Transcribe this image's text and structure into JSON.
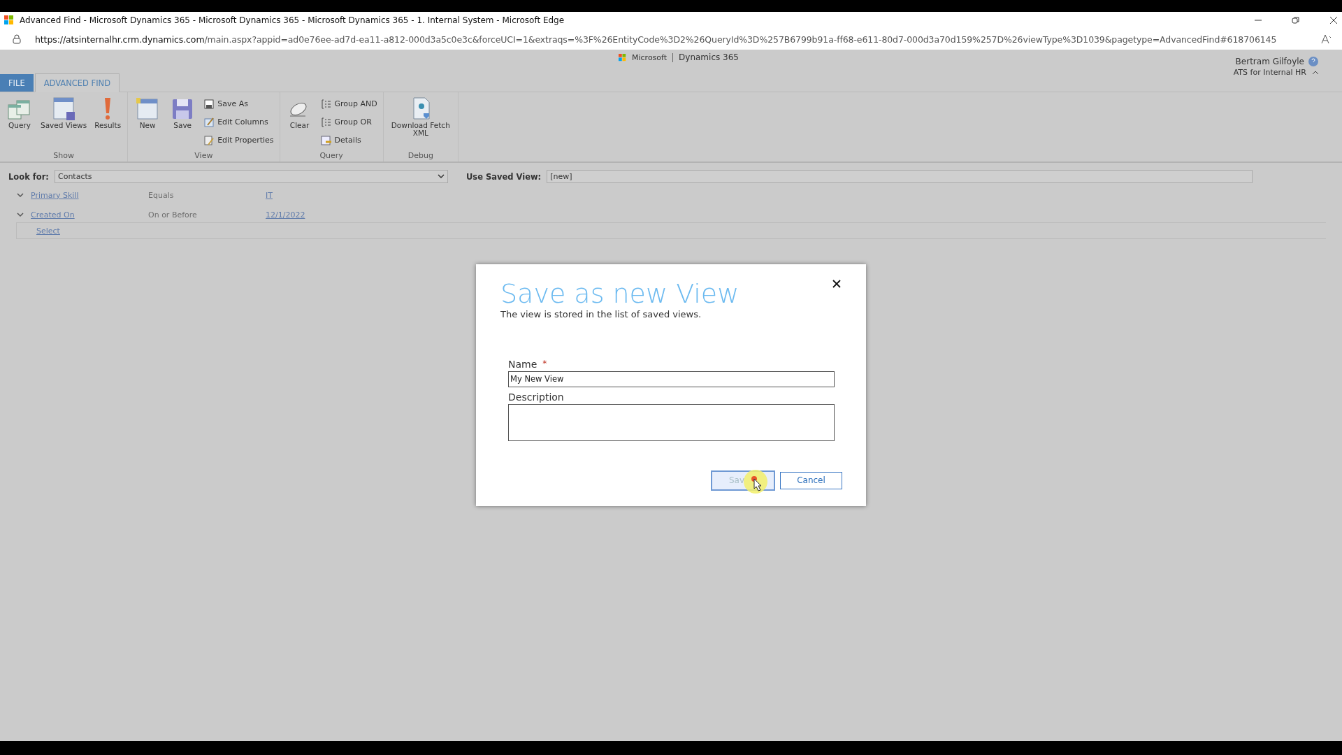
{
  "browser": {
    "title": "Advanced Find - Microsoft Dynamics 365 - Microsoft Dynamics 365 - Microsoft Dynamics 365 - 1. Internal System - Microsoft Edge",
    "url_host": "https://atsinternalhr.crm.dynamics.com",
    "url_rest": "/main.aspx?appid=ad0e76ee-ad7d-ea11-a812-000d3a5c0e3c&forceUCI=1&extraqs=%3F%26EntityCode%3D2%26QueryId%3D%257B6799b91a-ff68-e611-80d7-000d3a70d159%257D%26viewType%3D1039&pagetype=AdvancedFind#618706145"
  },
  "header": {
    "brand": "Microsoft",
    "product": "Dynamics 365",
    "user_name": "Bertram Gilfoyle",
    "org": "ATS for Internal HR"
  },
  "tabs": [
    {
      "label": "FILE",
      "kind": "file",
      "selected": false
    },
    {
      "label": "ADVANCED FIND",
      "kind": "tab",
      "selected": true
    }
  ],
  "ribbon_groups": [
    {
      "label": "Show",
      "items": [
        {
          "kind": "large",
          "label": "Query"
        },
        {
          "kind": "large",
          "label": "Saved Views"
        },
        {
          "kind": "large",
          "label": "Results"
        }
      ]
    },
    {
      "label": "View",
      "items": [
        {
          "kind": "large",
          "label": "New"
        },
        {
          "kind": "large",
          "label": "Save"
        },
        {
          "kind": "small",
          "label": "Save As"
        },
        {
          "kind": "small",
          "label": "Edit Columns"
        },
        {
          "kind": "small",
          "label": "Edit Properties"
        }
      ]
    },
    {
      "label": "Query",
      "items": [
        {
          "kind": "large",
          "label": "Clear"
        },
        {
          "kind": "small",
          "label": "Group AND"
        },
        {
          "kind": "small",
          "label": "Group OR"
        },
        {
          "kind": "small",
          "label": "Details"
        }
      ]
    },
    {
      "label": "Debug",
      "items": [
        {
          "kind": "large",
          "label": "Download Fetch XML"
        }
      ]
    }
  ],
  "look_for": {
    "label": "Look for:",
    "value": "Contacts"
  },
  "saved_view": {
    "label": "Use Saved View:",
    "value": "[new]"
  },
  "conditions": [
    {
      "field": "Primary Skill",
      "operator": "Equals",
      "value": "IT"
    },
    {
      "field": "Created On",
      "operator": "On or Before",
      "value": "12/1/2022"
    }
  ],
  "select_label": "Select",
  "dialog": {
    "title": "Save as new View",
    "subtitle": "The view is stored in the list of saved views.",
    "name_label": "Name",
    "required_mark": "*",
    "name_value": "My New View",
    "description_label": "Description",
    "save_label": "Sav",
    "cancel_label": "Cancel"
  }
}
